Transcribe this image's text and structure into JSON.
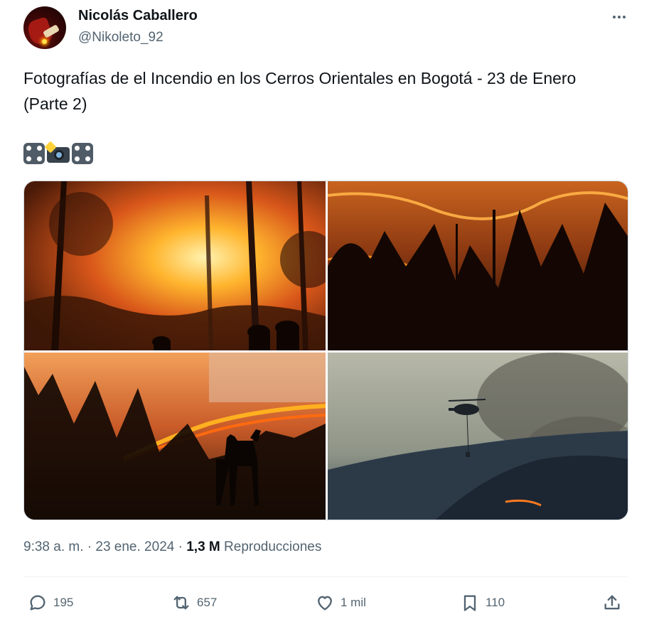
{
  "user": {
    "display_name": "Nicolás Caballero",
    "handle": "@Nikoleto_92",
    "avatar_icon": "avatar-photo"
  },
  "menu": {
    "icon": "more-horizontal-icon"
  },
  "tweet": {
    "text": "Fotografías de el Incendio en los Cerros Orientales en Bogotá - 23 de Enero (Parte 2)",
    "emojis": [
      "dice-emoji",
      "camera-flash-emoji",
      "dice-emoji"
    ]
  },
  "media": {
    "count": 4,
    "photos": [
      "forest-fire-firefighters",
      "burning-hillside-trees",
      "deer-silhouette-fire",
      "helicopter-water-drop"
    ]
  },
  "meta": {
    "time": "9:38 a. m.",
    "separator": "·",
    "date": "23 ene. 2024",
    "views": "1,3 M",
    "views_label": "Reproducciones"
  },
  "actions": {
    "replies": "195",
    "retweets": "657",
    "likes": "1 mil",
    "bookmarks": "110"
  },
  "colors": {
    "text": "#0f1419",
    "secondary": "#536471",
    "divider": "#eff3f4",
    "border": "#cfd9de"
  }
}
